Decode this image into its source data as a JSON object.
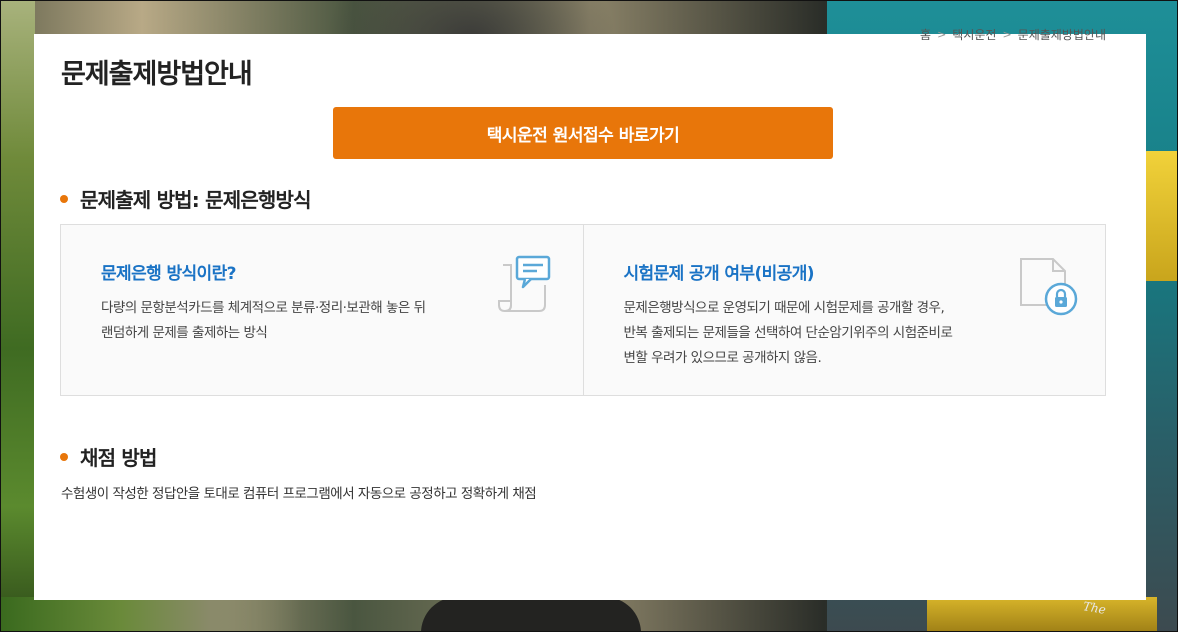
{
  "breadcrumb": {
    "items": [
      "홈",
      "택시운전",
      "문제출제방법안내"
    ]
  },
  "page": {
    "title": "문제출제방법안내"
  },
  "cta": {
    "label": "택시운전 원서접수 바로가기"
  },
  "sections": [
    {
      "heading": "문제출제 방법: 문제은행방식",
      "boxes": [
        {
          "title": "문제은행 방식이란?",
          "lines": [
            "다량의 문항분석카드를 체계적으로 분류·정리·보관해 놓은 뒤",
            "랜덤하게 문제를 출제하는 방식"
          ],
          "icon": "speech-bubble-document-icon"
        },
        {
          "title": "시험문제 공개 여부(비공개)",
          "lines": [
            "문제은행방식으로 운영되기 때문에 시험문제를 공개할 경우,",
            "반복 출제되는 문제들을 선택하여 단순암기위주의 시험준비로",
            "변할 우려가 있으므로 공개하지 않음."
          ],
          "icon": "locked-document-icon"
        }
      ]
    },
    {
      "heading": "채점 방법",
      "text": "수험생이 작성한 정답안을 토대로 컴퓨터 프로그램에서 자동으로 공정하고 정확하게 채점"
    }
  ],
  "photo": {
    "text": "The"
  },
  "colors": {
    "accent": "#e8760a",
    "link": "#1a73c5",
    "icon": "#5aa8d8"
  }
}
